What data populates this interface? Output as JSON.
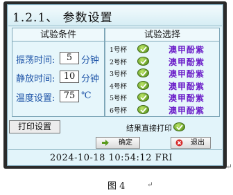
{
  "header": {
    "title": "1.2.1、 参数设置"
  },
  "conditions": {
    "heading": "试验条件",
    "rows": [
      {
        "label": "振荡时间:",
        "value": "5",
        "unit": "分钟"
      },
      {
        "label": "静放时间:",
        "value": "10",
        "unit": "分钟"
      },
      {
        "label": "温度设置:",
        "value": "75",
        "unit": "℃"
      }
    ]
  },
  "selection": {
    "heading": "试验选择",
    "cups": [
      {
        "label": "1号杯",
        "reagent": "澳甲酚紫",
        "checked": true
      },
      {
        "label": "2号杯",
        "reagent": "澳甲酚紫",
        "checked": true
      },
      {
        "label": "3号杯",
        "reagent": "澳甲酚紫",
        "checked": true
      },
      {
        "label": "4号杯",
        "reagent": "澳甲酚紫",
        "checked": true
      },
      {
        "label": "5号杯",
        "reagent": "澳甲酚紫",
        "checked": true
      },
      {
        "label": "6号杯",
        "reagent": "澳甲酚紫",
        "checked": true
      }
    ]
  },
  "print": {
    "settings_label": "打印设置",
    "direct_print_label": "结果直接打印",
    "direct_print_checked": true
  },
  "actions": {
    "confirm_label": "确定",
    "exit_label": "退出"
  },
  "status": {
    "datetime": "2024-10-18  10:54:12 FRI"
  },
  "caption": {
    "figure": "图 4"
  },
  "colors": {
    "screen_bg": "#e2f4fa",
    "reagent_text": "#6c1fc9",
    "label_text": "#1f55a8",
    "check_green": "#6aa22a"
  }
}
